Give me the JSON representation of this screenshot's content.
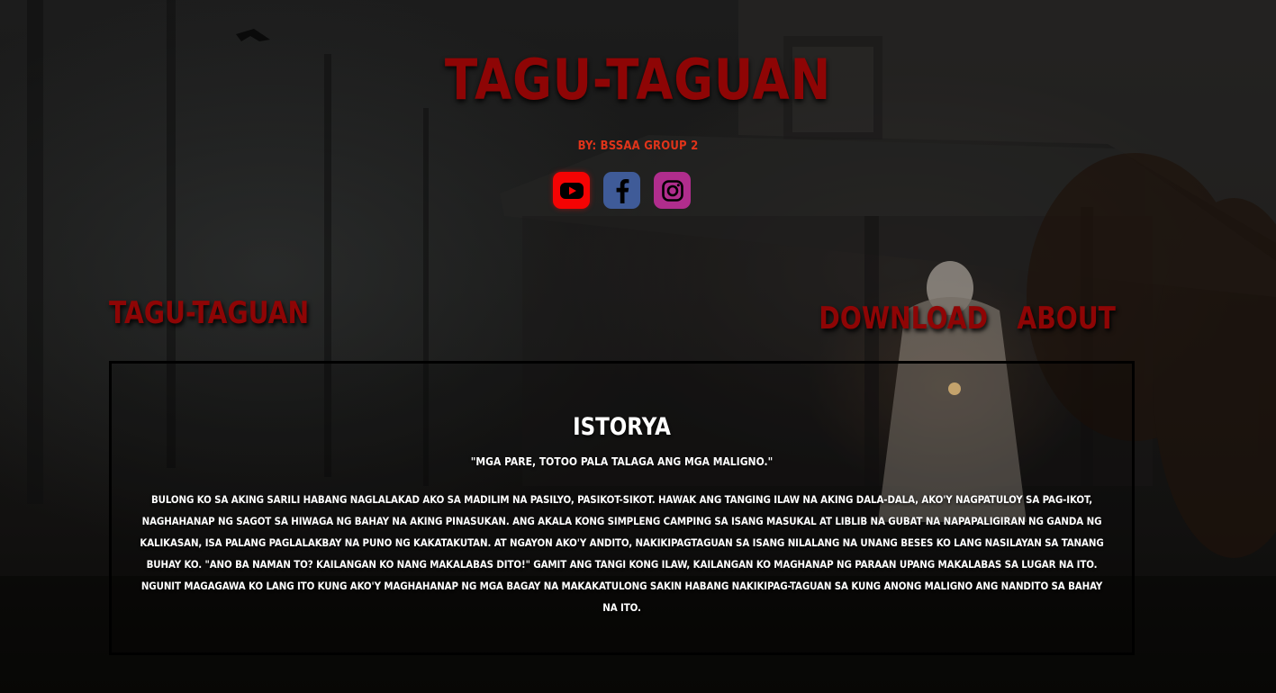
{
  "header": {
    "title": "TAGU-TAGUAN",
    "byline": "BY: BSSAA GROUP 2"
  },
  "socials": [
    {
      "name": "YouTube",
      "icon": "youtube-icon",
      "color": "#f50303"
    },
    {
      "name": "Facebook",
      "icon": "facebook-icon",
      "color": "#3f5b98"
    },
    {
      "name": "Instagram",
      "icon": "instagram-icon",
      "color": "#b02d8d"
    }
  ],
  "nav": {
    "logo": "TAGU-TAGUAN",
    "links": [
      "DOWNLOAD",
      "ABOUT"
    ]
  },
  "story": {
    "heading": "ISTORYA",
    "quote": "\"MGA PARE, TOTOO PALA TALAGA ANG MGA MALIGNO.\"",
    "body": "BULONG KO SA AKING SARILI HABANG NAGLALAKAD AKO SA MADILIM NA PASILYO, PASIKOT-SIKOT. HAWAK ANG TANGING ILAW NA AKING DALA-DALA, AKO'Y NAGPATULOY SA PAG-IKOT, NAGHAHANAP NG SAGOT SA HIWAGA NG BAHAY NA AKING PINASUKAN. ANG AKALA KONG SIMPLENG CAMPING SA ISANG MASUKAL AT LIBLIB NA GUBAT NA NAPAPALIGIRAN NG GANDA NG KALIKASAN, ISA PALANG PAGLALAKBAY NA PUNO NG KAKATAKUTAN. AT NGAYON AKO'Y ANDITO, NAKIKIPAGTAGUAN SA ISANG NILALANG NA UNANG BESES KO LANG NASILAYAN SA TANANG BUHAY KO. \"ANO BA NAMAN TO? KAILANGAN KO NANG MAKALABAS DITO!\" GAMIT ANG TANGI KONG ILAW, KAILANGAN KO MAGHANAP NG PARAAN UPANG MAKALABAS SA LUGAR NA ITO. NGUNIT MAGAGAWA KO LANG ITO KUNG AKO'Y MAGHAHANAP NG MGA BAGAY NA MAKAKATULONG SAKIN HABANG NAKIKIPAG-TAGUAN SA KUNG ANONG MALIGNO ANG NANDITO SA BAHAY NA ITO."
  },
  "colors": {
    "title_red": "#8e0505",
    "byline_orange": "#e0341a",
    "text_white": "#ffffff",
    "box_border": "#000000"
  }
}
